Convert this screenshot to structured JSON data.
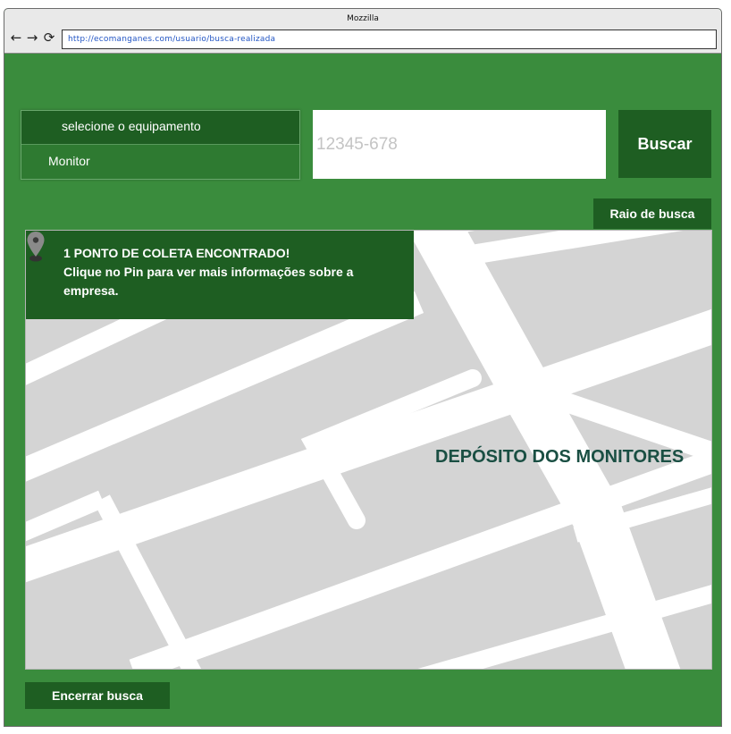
{
  "browser": {
    "title": "Mozzilla",
    "url": "http://ecomanganes.com/usuario/busca-realizada",
    "back_icon": "arrow-left-icon",
    "forward_icon": "arrow-right-icon",
    "reload_icon": "reload-icon"
  },
  "form": {
    "equipment_header": "selecione o equipamento",
    "equipment_selected": "Monitor",
    "cep_placeholder": "12345-678",
    "search_label": "Buscar",
    "radius_label": "Raio de busca"
  },
  "map": {
    "result_line1": "1 PONTO DE COLETA ENCONTRADO!",
    "result_line2": "Clique no Pin para ver mais informações sobre a empresa.",
    "place_name": "DEPÓSITO DOS MONITORES",
    "pin_icon": "map-pin-icon"
  },
  "footer": {
    "end_label": "Encerrar busca"
  },
  "colors": {
    "background": "#3a8c3d",
    "dark_green": "#1e5e22",
    "map_gray": "#d4d4d4",
    "road": "#ffffff",
    "place_label": "#1a4f43"
  }
}
